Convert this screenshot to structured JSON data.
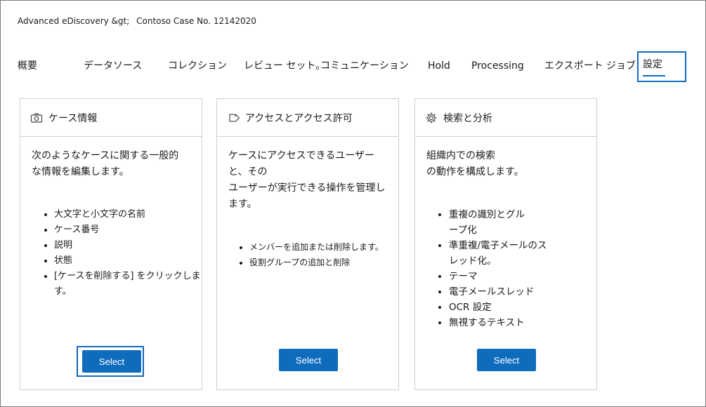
{
  "breadcrumb": {
    "parent": "Advanced eDiscovery &gt;",
    "current": "Contoso Case No. 12142020"
  },
  "tabs": [
    {
      "label": "概要"
    },
    {
      "label": "データソース"
    },
    {
      "label": "コレクション"
    },
    {
      "label": "レビュー セット。"
    },
    {
      "label": "コミュニケーション"
    },
    {
      "label": "Hold"
    },
    {
      "label": "Processing"
    },
    {
      "label": "エクスポート ジョブ"
    },
    {
      "label": "設定",
      "active": true
    }
  ],
  "cards": [
    {
      "icon": "camera-icon",
      "title": "ケース情報",
      "description": "次のようなケースに関する一般的\nな情報を編集します。",
      "items": [
        "大文字と小文字の名前",
        "ケース番号",
        "説明",
        "状態",
        "[ケースを削除する] をクリックします。"
      ],
      "button": "Select"
    },
    {
      "icon": "tag-icon",
      "title": "アクセスとアクセス許可",
      "description": "ケースにアクセスできるユーザーと、その\nユーザーが実行できる操作を管理します。",
      "items": [
        "メンバーを追加または削除します。",
        "役割グループの追加と削除"
      ],
      "button": "Select"
    },
    {
      "icon": "gear-icon",
      "title": "検索と分析",
      "description": "組織内での検索\nの動作を構成します。",
      "items": [
        "重複の識別とグル\nープ化",
        "準重複/電子メールのス\nレッド化。",
        "テーマ",
        "電子メールスレッド",
        "OCR 設定",
        "無視するテキスト"
      ],
      "button": "Select"
    }
  ]
}
